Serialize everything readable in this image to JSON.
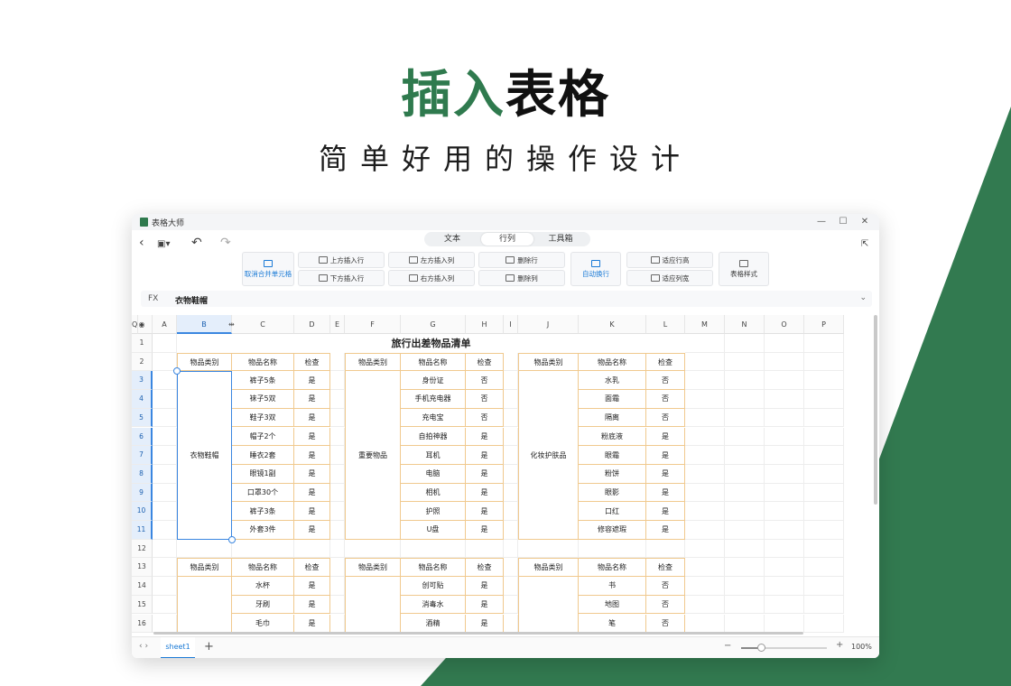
{
  "hero": {
    "title_green": "插入",
    "title_black": "表格",
    "subtitle": "简单好用的操作设计"
  },
  "colors": {
    "brand_green": "#2f7a4e",
    "accent_blue": "#1a7ad6",
    "table_border": "#f0c98e",
    "selection": "#cfe3fb"
  },
  "window": {
    "title": "表格大师",
    "minimize_icon": "minimize-icon",
    "maximize_icon": "maximize-icon",
    "close_icon": "close-icon"
  },
  "nav": {
    "back": "‹",
    "undo": "↶",
    "redo": "↷"
  },
  "tabs": [
    {
      "label": "文本"
    },
    {
      "label": "行列"
    },
    {
      "label": "工具箱"
    }
  ],
  "ribbon": {
    "unmerge": "取消合并单元格",
    "insert_above": "上方插入行",
    "insert_below": "下方插入行",
    "insert_left": "左方插入列",
    "insert_right": "右方插入列",
    "delete_row": "删除行",
    "delete_col": "删除列",
    "wrap": "自动换行",
    "fit_height": "适应行高",
    "fit_width": "适应列宽",
    "table_style": "表格样式"
  },
  "formula": {
    "label": "FX",
    "value": "衣物鞋帽"
  },
  "columns": [
    "A",
    "B",
    "C",
    "D",
    "E",
    "F",
    "G",
    "H",
    "I",
    "J",
    "K",
    "L",
    "M",
    "N",
    "O",
    "P",
    "Q"
  ],
  "rows": [
    "1",
    "2",
    "3",
    "4",
    "5",
    "6",
    "7",
    "8",
    "9",
    "10",
    "11",
    "12",
    "13",
    "14",
    "15",
    "16"
  ],
  "sheet": {
    "title": "旅行出差物品清单",
    "header": [
      "物品类别",
      "物品名称",
      "检查"
    ],
    "block1": {
      "category": "衣物鞋帽",
      "items": [
        [
          "裤子5条",
          "是"
        ],
        [
          "袜子5双",
          "是"
        ],
        [
          "鞋子3双",
          "是"
        ],
        [
          "帽子2个",
          "是"
        ],
        [
          "睡衣2套",
          "是"
        ],
        [
          "眼镜1副",
          "是"
        ],
        [
          "口罩30个",
          "是"
        ],
        [
          "裤子3条",
          "是"
        ],
        [
          "外套3件",
          "是"
        ]
      ]
    },
    "block2": {
      "category": "重要物品",
      "items": [
        [
          "身份证",
          "否"
        ],
        [
          "手机充电器",
          "否"
        ],
        [
          "充电宝",
          "否"
        ],
        [
          "自拍神器",
          "是"
        ],
        [
          "耳机",
          "是"
        ],
        [
          "电脑",
          "是"
        ],
        [
          "相机",
          "是"
        ],
        [
          "护照",
          "是"
        ],
        [
          "U盘",
          "是"
        ]
      ]
    },
    "block3": {
      "category": "化妆护肤品",
      "items": [
        [
          "水乳",
          "否"
        ],
        [
          "面霜",
          "否"
        ],
        [
          "隔离",
          "否"
        ],
        [
          "粉底液",
          "是"
        ],
        [
          "眼霜",
          "是"
        ],
        [
          "粉饼",
          "是"
        ],
        [
          "眼影",
          "是"
        ],
        [
          "口红",
          "是"
        ],
        [
          "修容遮瑕",
          "是"
        ]
      ]
    },
    "block4": {
      "items": [
        [
          "水杯",
          "是"
        ],
        [
          "牙刷",
          "是"
        ],
        [
          "毛巾",
          "是"
        ]
      ]
    },
    "block5": {
      "items": [
        [
          "创可贴",
          "是"
        ],
        [
          "消毒水",
          "是"
        ],
        [
          "酒精",
          "是"
        ]
      ]
    },
    "block6": {
      "items": [
        [
          "书",
          "否"
        ],
        [
          "地图",
          "否"
        ],
        [
          "笔",
          "否"
        ]
      ]
    }
  },
  "bottom": {
    "nav": "‹ ›",
    "sheet_tab": "sheet1",
    "add": "+",
    "zoom_minus": "−",
    "zoom_plus": "+",
    "zoom": "100%"
  }
}
